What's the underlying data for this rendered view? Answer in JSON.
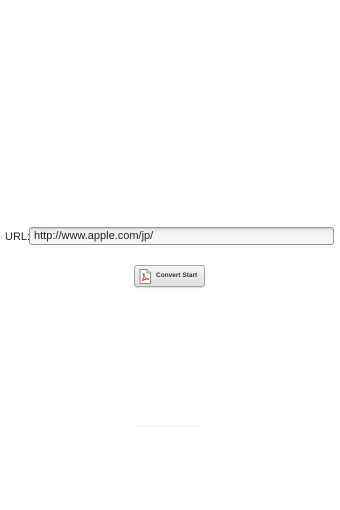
{
  "form": {
    "url_label": "URL:",
    "url_value": "http://www.apple.com/jp/",
    "convert_button_label": "Convert Start",
    "convert_button_icon": "pdf-document-icon"
  },
  "colors": {
    "background": "#ffffff",
    "field_border": "#9a9a9a",
    "icon_accent": "#c8281e"
  }
}
